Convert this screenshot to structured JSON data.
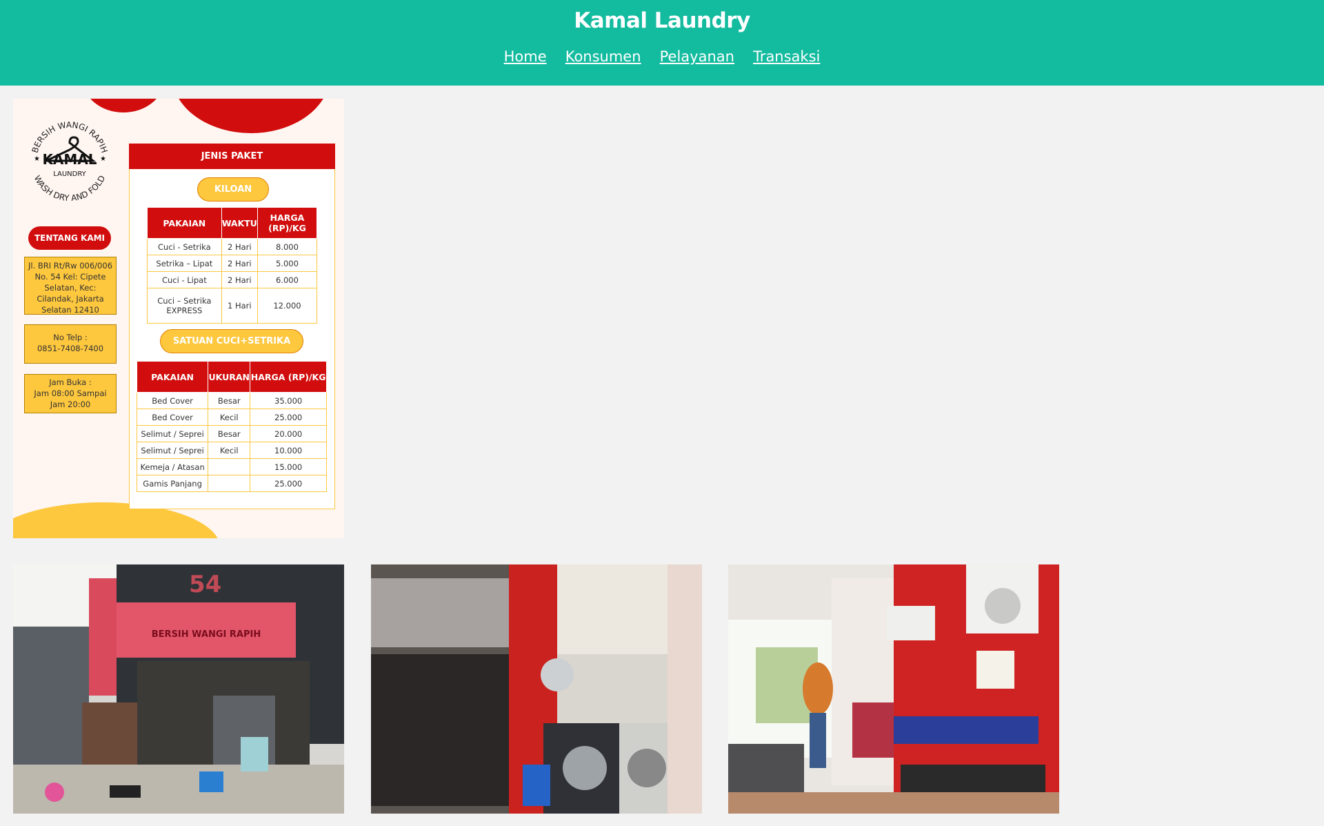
{
  "header": {
    "title": "Kamal Laundry",
    "nav": [
      "Home",
      "Konsumen",
      "Pelayanan",
      "Transaksi"
    ]
  },
  "flyer": {
    "logo": {
      "arc_top": "BERSIH WANGI RAPIH",
      "arc_bottom": "WASH DRY AND FOLD",
      "brand": "KAMAL",
      "sub": "LAUNDRY"
    },
    "about_label": "TENTANG KAMI",
    "address": "Jl. BRI Rt/Rw 006/006 No. 54 Kel: Cipete Selatan, Kec: Cilandak, Jakarta Selatan 12410",
    "phone_label": "No Telp :",
    "phone": "0851-7408-7400",
    "hours_label": "Jam Buka :",
    "hours": "Jam 08:00 Sampai Jam 20:00",
    "packages_title": "JENIS PAKET",
    "kiloan": {
      "label": "KILOAN",
      "headers": [
        "PAKAIAN",
        "WAKTU",
        "HARGA (RP)/KG"
      ],
      "rows": [
        [
          "Cuci - Setrika",
          "2 Hari",
          "8.000"
        ],
        [
          "Setrika – Lipat",
          "2 Hari",
          "5.000"
        ],
        [
          "Cuci - Lipat",
          "2 Hari",
          "6.000"
        ],
        [
          "Cuci – Setrika EXPRESS",
          "1 Hari",
          "12.000"
        ]
      ]
    },
    "satuan": {
      "label": "SATUAN CUCI+SETRIKA",
      "headers": [
        "PAKAIAN",
        "UKURAN",
        "HARGA (RP)/KG"
      ],
      "rows": [
        [
          "Bed Cover",
          "Besar",
          "35.000"
        ],
        [
          "Bed Cover",
          "Kecil",
          "25.000"
        ],
        [
          "Selimut / Seprei",
          "Besar",
          "20.000"
        ],
        [
          "Selimut / Seprei",
          "Kecil",
          "10.000"
        ],
        [
          "Kemeja / Atasan",
          "",
          "15.000"
        ],
        [
          "Gamis Panjang",
          "",
          "25.000"
        ]
      ]
    }
  },
  "photos": [
    {
      "name": "storefront-photo",
      "banner_text": "BERSIH WANGI RAPIH",
      "sign_number": "54"
    },
    {
      "name": "interior-shelves-photo"
    },
    {
      "name": "interior-ironing-photo"
    }
  ],
  "colors": {
    "header_bg": "#13bb9f",
    "page_bg": "#f2f2f2",
    "flyer_red": "#d10d0d",
    "flyer_yellow": "#fdc73e"
  }
}
